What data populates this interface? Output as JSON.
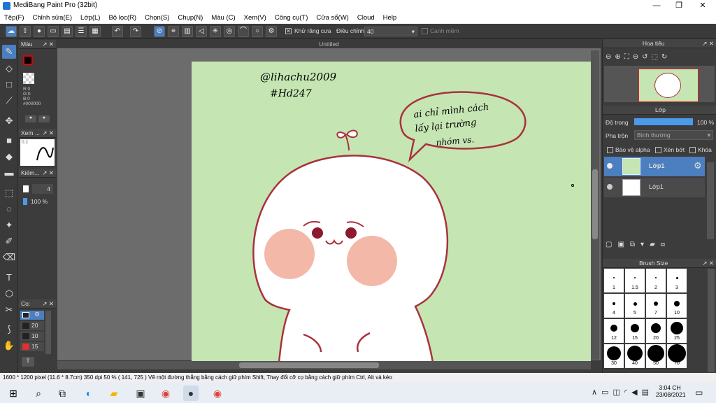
{
  "title": "MediBang Paint Pro (32bit)",
  "menu": [
    "Tệp(F)",
    "Chỉnh sửa(E)",
    "Lớp(L)",
    "Bộ lọc(R)",
    "Chọn(S)",
    "Chụp(N)",
    "Màu (C)",
    "Xem(V)",
    "Công cụ(T)",
    "Cửa sổ(W)",
    "Cloud",
    "Help"
  ],
  "toolbar": {
    "antialias_label": "Khử răng cưa",
    "adjust_label": "Điều chỉnh",
    "adjust_value": "40",
    "edge_label": "Canh mềm"
  },
  "color_panel": {
    "title": "Màu",
    "r": "R:0",
    "g": "G:0",
    "b": "B:0",
    "hex": "#000000"
  },
  "preview_panel": {
    "title": "Xem ...",
    "scale": "0.2"
  },
  "check_panel": {
    "title": "Kiếm...",
    "size": "4",
    "opacity": "100 %"
  },
  "col_panel": {
    "title": "Co:",
    "items": [
      "20",
      "10",
      "15"
    ]
  },
  "doc_title": "Untitled",
  "drawing": {
    "signature_line1": "@lihachu2009",
    "signature_line2": "#Hd247",
    "bubble_line1": "ai chỉ mình cách",
    "bubble_line2": "lấy lại trường",
    "bubble_line3": "nhóm vs."
  },
  "navigator": {
    "title": "Hoa tiêu"
  },
  "layer_panel": {
    "title": "Lớp",
    "opacity_label": "Độ trong",
    "opacity_value": "100 %",
    "blend_label": "Pha trộn",
    "blend_value": "Bình thường",
    "protect_alpha": "Bảo vệ alpha",
    "clip": "Xén bớt",
    "lock": "Khóa",
    "layers": [
      {
        "name": "Lớp1",
        "selected": true
      },
      {
        "name": "Lớp1",
        "selected": false
      }
    ]
  },
  "brush_size": {
    "title": "Brush Size",
    "sizes": [
      "1",
      "1.5",
      "2",
      "3",
      "4",
      "5",
      "7",
      "10",
      "12",
      "15",
      "20",
      "25",
      "30",
      "40",
      "50",
      "70"
    ]
  },
  "status": "1600 * 1200 pixel   (11.6 * 8.7cm)   350 dpi   50 %   ( 141, 725 )   Vẽ một đường thẳng bằng cách giữ phím Shift, Thay đổi cỡ cọ bằng cách giữ phím Ctrl, Alt và kéo",
  "taskbar": {
    "time": "3:04 CH",
    "date": "23/08/2021"
  },
  "colors": {
    "accent": "#4b7fbf",
    "paper": "#c5e5b3",
    "outline": "#a8323c",
    "cheek": "#f4b8a8"
  }
}
